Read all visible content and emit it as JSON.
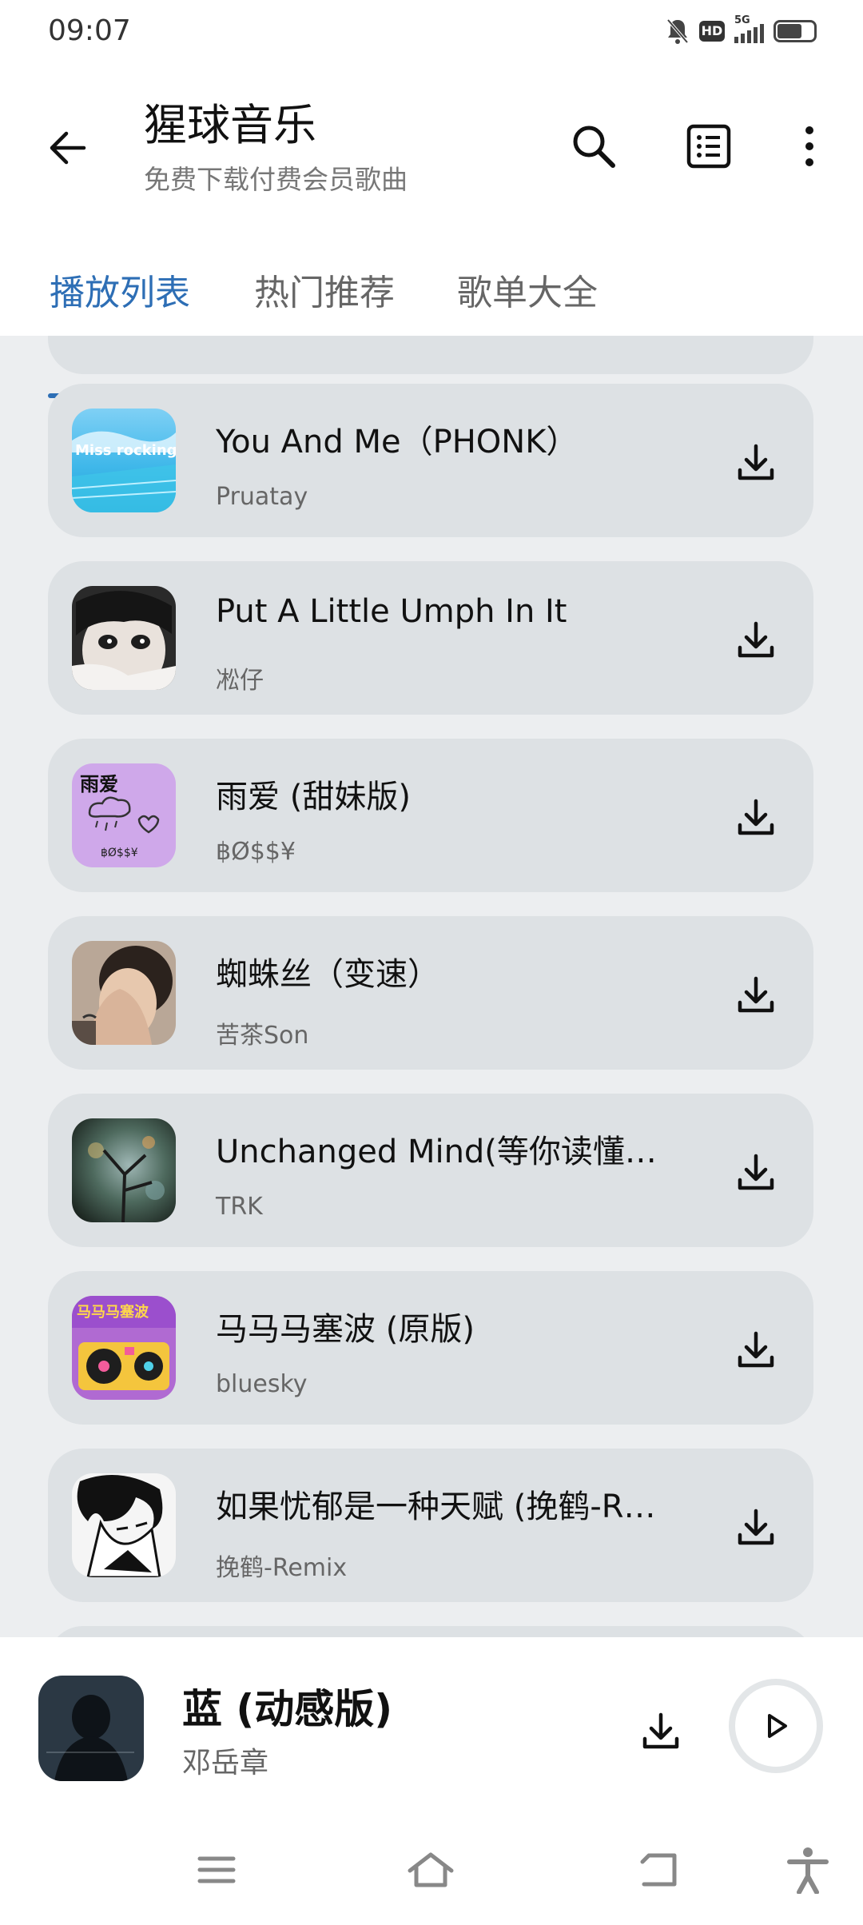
{
  "status_bar": {
    "time": "09:07",
    "hd": "HD",
    "network": "5G"
  },
  "header": {
    "title": "猩球音乐",
    "subtitle": "免费下载付费会员歌曲",
    "icons": [
      "back-icon",
      "search-icon",
      "list-icon",
      "more-icon"
    ]
  },
  "tabs": [
    {
      "label": "播放列表",
      "active": true
    },
    {
      "label": "热门推荐",
      "active": false
    },
    {
      "label": "歌单大全",
      "active": false
    }
  ],
  "songs": [
    {
      "title": "You And Me（PHONK）",
      "artist": "Pruatay",
      "cover_text": "Miss rocking"
    },
    {
      "title": "Put A Little Umph In It",
      "artist": "凇仔"
    },
    {
      "title": "雨爱 (甜妹版)",
      "artist": "฿Ø$$¥",
      "cover_text": "雨爱"
    },
    {
      "title": "蜘蛛丝（变速）",
      "artist": "苦茶Son"
    },
    {
      "title": "Unchanged Mind(等你读懂…",
      "artist": "TRK"
    },
    {
      "title": "马马马塞波 (原版)",
      "artist": "bluesky",
      "cover_text": "马马马塞波"
    },
    {
      "title": "如果忧郁是一种天赋 (挽鹤-R…",
      "artist": "挽鹤-Remix"
    }
  ],
  "now_playing": {
    "title": "蓝 (动感版)",
    "artist": "邓岳章"
  },
  "nav": [
    "menu-icon",
    "home-icon",
    "back-nav-icon",
    "accessibility-icon"
  ],
  "colors": {
    "accent": "#2d6eb5",
    "card": "#dde1e4",
    "background": "#eceef0"
  }
}
